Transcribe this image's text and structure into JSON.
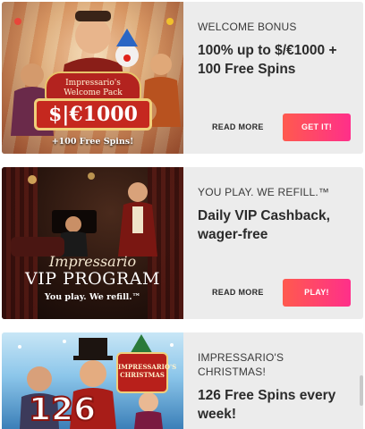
{
  "promotions": [
    {
      "tag": "WELCOME BONUS",
      "title": "100% up to $/€1000 + 100 Free Spins",
      "read_more": "READ MORE",
      "cta": "GET IT!",
      "image": {
        "ribbon_line1": "Impressario's",
        "ribbon_line2": "Welcome Pack",
        "amount": "$|€1000",
        "sub": "+100 Free Spins!"
      }
    },
    {
      "tag": "YOU PLAY. WE REFILL.™",
      "title": "Daily VIP Cashback, wager-free",
      "read_more": "READ MORE",
      "cta": "PLAY!",
      "image": {
        "title_script": "Impressario",
        "program": "VIP PROGRAM",
        "sub": "You play. We refill.™"
      }
    },
    {
      "tag": "IMPRESSARIO'S CHRISTMAS!",
      "title": "126 Free Spins every week!",
      "image": {
        "badge_line1": "IMPRESSARIO'S",
        "badge_line2": "CHRISTMAS",
        "number": "126"
      }
    }
  ],
  "colors": {
    "card_bg": "#ececec",
    "cta_gradient_start": "#ff5a4e",
    "cta_gradient_end": "#ff2f8a"
  }
}
